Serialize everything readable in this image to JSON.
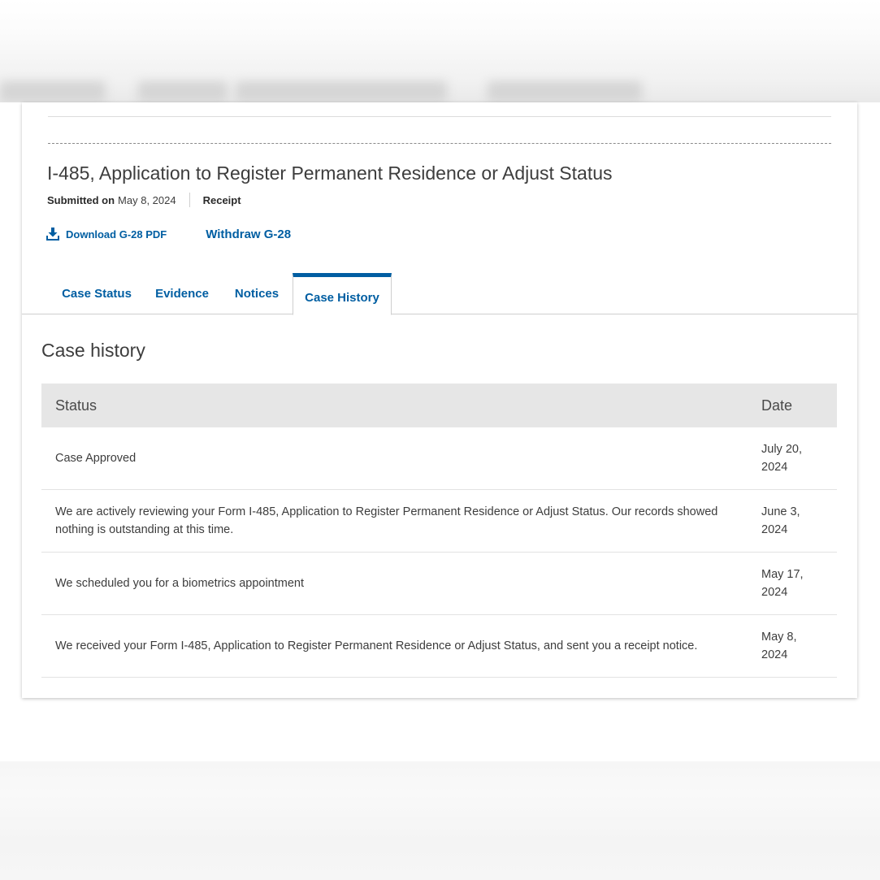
{
  "form": {
    "title": "I-485, Application to Register Permanent Residence or Adjust Status",
    "submitted_label": "Submitted on",
    "submitted_date": "May 8, 2024",
    "receipt_label": "Receipt",
    "download_label": "Download G-28 PDF",
    "withdraw_label": "Withdraw G-28"
  },
  "tabs": [
    {
      "label": "Case Status",
      "active": false
    },
    {
      "label": "Evidence",
      "active": false
    },
    {
      "label": "Notices",
      "active": false
    },
    {
      "label": "Case History",
      "active": true
    }
  ],
  "history": {
    "title": "Case history",
    "columns": [
      "Status",
      "Date"
    ],
    "rows": [
      {
        "status": "Case Approved",
        "date": "July 20, 2024"
      },
      {
        "status": "We are actively reviewing your Form I-485, Application to Register Permanent Residence or Adjust Status. Our records showed nothing is outstanding at this time.",
        "date": "June 3, 2024"
      },
      {
        "status": "We scheduled you for a biometrics appointment",
        "date": "May 17, 2024"
      },
      {
        "status": "We received your Form I-485, Application to Register Permanent Residence or Adjust Status, and sent you a receipt notice.",
        "date": "May 8, 2024"
      }
    ]
  },
  "colors": {
    "accent": "#005ea2",
    "header_bg": "#e6e6e6",
    "text": "#3d3d3d"
  },
  "icons": {
    "download": "download-icon"
  }
}
